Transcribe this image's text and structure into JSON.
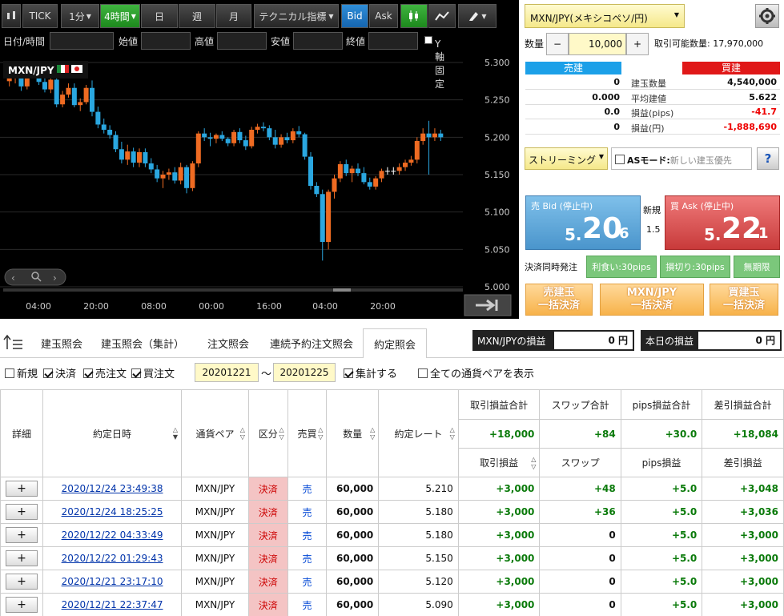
{
  "toolbar": {
    "tick": "TICK",
    "min1": "1分",
    "h4": "4時間",
    "day": "日",
    "week": "週",
    "month": "月",
    "technical": "テクニカル指標",
    "bid": "Bid",
    "ask": "Ask"
  },
  "fields": {
    "datetime": "日付/時間",
    "open": "始値",
    "high": "高値",
    "low": "安値",
    "close": "終値",
    "yfix": "Y軸固定"
  },
  "chart": {
    "symbol": "MXN/JPY",
    "yticks": [
      "5.300",
      "5.250",
      "5.200",
      "5.150",
      "5.100",
      "5.050",
      "5.000"
    ],
    "xticks": [
      "04:00",
      "20:00",
      "08:00",
      "00:00",
      "16:00",
      "04:00",
      "20:00"
    ],
    "colors": {
      "up": "#ef6b22",
      "down": "#2aa7e0",
      "doji": "#ffffff"
    },
    "candles": [
      [
        5.275,
        5.283,
        5.268,
        5.279
      ],
      [
        5.279,
        5.29,
        5.272,
        5.284
      ],
      [
        5.284,
        5.292,
        5.262,
        5.268
      ],
      [
        5.268,
        5.289,
        5.264,
        5.285
      ],
      [
        5.285,
        5.291,
        5.279,
        5.287
      ],
      [
        5.287,
        5.294,
        5.27,
        5.274
      ],
      [
        5.274,
        5.282,
        5.26,
        5.264
      ],
      [
        5.264,
        5.283,
        5.259,
        5.277
      ],
      [
        5.277,
        5.285,
        5.24,
        5.244
      ],
      [
        5.244,
        5.262,
        5.24,
        5.257
      ],
      [
        5.257,
        5.272,
        5.253,
        5.266
      ],
      [
        5.266,
        5.272,
        5.24,
        5.243
      ],
      [
        5.243,
        5.252,
        5.235,
        5.247
      ],
      [
        5.247,
        5.27,
        5.244,
        5.266
      ],
      [
        5.266,
        5.276,
        5.228,
        5.234
      ],
      [
        5.234,
        5.241,
        5.212,
        5.217
      ],
      [
        5.217,
        5.225,
        5.205,
        5.21
      ],
      [
        5.21,
        5.216,
        5.198,
        5.203
      ],
      [
        5.203,
        5.208,
        5.18,
        5.184
      ],
      [
        5.184,
        5.194,
        5.165,
        5.17
      ],
      [
        5.17,
        5.19,
        5.163,
        5.181
      ],
      [
        5.181,
        5.186,
        5.16,
        5.166
      ],
      [
        5.166,
        5.185,
        5.16,
        5.18
      ],
      [
        5.18,
        5.185,
        5.16,
        5.165
      ],
      [
        5.165,
        5.172,
        5.152,
        5.157
      ],
      [
        5.157,
        5.163,
        5.14,
        5.145
      ],
      [
        5.145,
        5.155,
        5.132,
        5.15
      ],
      [
        5.15,
        5.158,
        5.143,
        5.153
      ],
      [
        5.153,
        5.16,
        5.138,
        5.142
      ],
      [
        5.142,
        5.166,
        5.137,
        5.16
      ],
      [
        5.16,
        5.163,
        5.125,
        5.132
      ],
      [
        5.132,
        5.168,
        5.128,
        5.165
      ],
      [
        5.165,
        5.208,
        5.16,
        5.205
      ],
      [
        5.205,
        5.212,
        5.195,
        5.2
      ],
      [
        5.2,
        5.206,
        5.188,
        5.198
      ],
      [
        5.198,
        5.205,
        5.192,
        5.203
      ],
      [
        5.203,
        5.208,
        5.195,
        5.198
      ],
      [
        5.198,
        5.2,
        5.188,
        5.192
      ],
      [
        5.192,
        5.21,
        5.188,
        5.207
      ],
      [
        5.207,
        5.212,
        5.192,
        5.196
      ],
      [
        5.196,
        5.202,
        5.183,
        5.188
      ],
      [
        5.188,
        5.214,
        5.185,
        5.21
      ],
      [
        5.21,
        5.218,
        5.205,
        5.214
      ],
      [
        5.214,
        5.22,
        5.208,
        5.212
      ],
      [
        5.212,
        5.216,
        5.196,
        5.2
      ],
      [
        5.2,
        5.21,
        5.185,
        5.19
      ],
      [
        5.19,
        5.204,
        5.186,
        5.2
      ],
      [
        5.2,
        5.206,
        5.192,
        5.196
      ],
      [
        5.196,
        5.212,
        5.192,
        5.208
      ],
      [
        5.208,
        5.215,
        5.2,
        5.204
      ],
      [
        5.204,
        5.206,
        5.17,
        5.174
      ],
      [
        5.174,
        5.18,
        5.13,
        5.135
      ],
      [
        5.135,
        5.14,
        5.12,
        5.124
      ],
      [
        5.124,
        5.13,
        5.035,
        5.06
      ],
      [
        5.06,
        5.13,
        5.05,
        5.127
      ],
      [
        5.127,
        5.15,
        5.118,
        5.145
      ],
      [
        5.145,
        5.168,
        5.14,
        5.164
      ],
      [
        5.164,
        5.17,
        5.148,
        5.152
      ],
      [
        5.152,
        5.162,
        5.14,
        5.158
      ],
      [
        5.158,
        5.165,
        5.148,
        5.152
      ],
      [
        5.152,
        5.16,
        5.137,
        5.14
      ],
      [
        5.14,
        5.146,
        5.13,
        5.134
      ],
      [
        5.134,
        5.148,
        5.13,
        5.145
      ],
      [
        5.145,
        5.158,
        5.14,
        5.155
      ],
      [
        5.155,
        5.16,
        5.15,
        5.155
      ],
      [
        5.155,
        5.16,
        5.15,
        5.155
      ],
      [
        5.155,
        5.165,
        5.15,
        5.16
      ],
      [
        5.16,
        5.17,
        5.155,
        5.166
      ],
      [
        5.166,
        5.175,
        5.162,
        5.17
      ],
      [
        5.17,
        5.2,
        5.165,
        5.195
      ],
      [
        5.195,
        5.212,
        5.19,
        5.205
      ],
      [
        5.205,
        5.222,
        5.15,
        5.2
      ],
      [
        5.2,
        5.212,
        5.195,
        5.205
      ],
      [
        5.205,
        5.21,
        5.195,
        5.2
      ]
    ]
  },
  "right": {
    "pair": "MXN/JPY(メキシコペソ/円)",
    "qty_label": "数量",
    "qty": "10,000",
    "minus": "−",
    "plus": "+",
    "avail": "取引可能数量: 17,970,000",
    "sell_hdr": "売建",
    "buy_hdr": "買建",
    "rows": [
      {
        "s": "0",
        "l": "建玉数量",
        "b": "4,540,000"
      },
      {
        "s": "0.000",
        "l": "平均建値",
        "b": "5.622"
      },
      {
        "s": "0.0",
        "l": "損益(pips)",
        "b": "-41.7"
      },
      {
        "s": "0",
        "l": "損益(円)",
        "b": "-1,888,690"
      }
    ],
    "streaming": "ストリーミング",
    "as_mode": "ASモード:",
    "as_mode_ph": "新しい建玉優先",
    "help": "?",
    "bid_label": "売 Bid (停止中)",
    "bid_main": "5.20",
    "bid_small": "6",
    "bid_prefix": "5.",
    "bid_big": "20",
    "ask_label": "買 Ask (停止中)",
    "ask_prefix": "5.",
    "ask_big": "22",
    "ask_small": "1",
    "new_label": "新規",
    "spread": "1.5",
    "settle_label": "決済同時発注",
    "take_profit": "利食い:30pips",
    "stop_loss": "損切り:30pips",
    "unlimited": "無期限",
    "btn1a": "売建玉",
    "btn1b": "一括決済",
    "btn2a": "MXN/JPY",
    "btn2b": "一括決済",
    "btn3a": "買建玉",
    "btn3b": "一括決済"
  },
  "bottom": {
    "tabs": [
      "建玉照会",
      "建玉照会（集計）",
      "注文照会",
      "連続予約注文照会",
      "約定照会"
    ],
    "pl_pair_label": "MXN/JPYの損益",
    "pl_pair_val": "0 円",
    "pl_day_label": "本日の損益",
    "pl_day_val": "0 円",
    "f_new": "新規",
    "f_settle": "決済",
    "f_sell": "売注文",
    "f_buy": "買注文",
    "date_from": "20201221",
    "tilde": "〜",
    "date_to": "20201225",
    "f_agg": "集計する",
    "f_all": "全ての通貨ペアを表示",
    "headers": {
      "detail": "詳細",
      "datetime": "約定日時",
      "pair": "通貨ペア",
      "kubun": "区分",
      "side": "売買",
      "qty": "数量",
      "rate": "約定レート",
      "pl_sum": "取引損益合計",
      "swap_sum": "スワップ合計",
      "pips_sum": "pips損益合計",
      "net_sum": "差引損益合計",
      "pl": "取引損益",
      "swap": "スワップ",
      "pips": "pips損益",
      "net": "差引損益"
    },
    "totals": {
      "pl": "+18,000",
      "swap": "+84",
      "pips": "+30.0",
      "net": "+18,084"
    },
    "rows": [
      {
        "btn": "+",
        "dt": "2020/12/24 23:49:38",
        "pair": "MXN/JPY",
        "kubun": "決済",
        "side": "売",
        "qty": "60,000",
        "rate": "5.210",
        "pl": "+3,000",
        "swap": "+48",
        "pips": "+5.0",
        "net": "+3,048"
      },
      {
        "btn": "+",
        "dt": "2020/12/24 18:25:25",
        "pair": "MXN/JPY",
        "kubun": "決済",
        "side": "売",
        "qty": "60,000",
        "rate": "5.180",
        "pl": "+3,000",
        "swap": "+36",
        "pips": "+5.0",
        "net": "+3,036"
      },
      {
        "btn": "+",
        "dt": "2020/12/22 04:33:49",
        "pair": "MXN/JPY",
        "kubun": "決済",
        "side": "売",
        "qty": "60,000",
        "rate": "5.180",
        "pl": "+3,000",
        "swap": "0",
        "pips": "+5.0",
        "net": "+3,000"
      },
      {
        "btn": "+",
        "dt": "2020/12/22 01:29:43",
        "pair": "MXN/JPY",
        "kubun": "決済",
        "side": "売",
        "qty": "60,000",
        "rate": "5.150",
        "pl": "+3,000",
        "swap": "0",
        "pips": "+5.0",
        "net": "+3,000"
      },
      {
        "btn": "+",
        "dt": "2020/12/21 23:17:10",
        "pair": "MXN/JPY",
        "kubun": "決済",
        "side": "売",
        "qty": "60,000",
        "rate": "5.120",
        "pl": "+3,000",
        "swap": "0",
        "pips": "+5.0",
        "net": "+3,000"
      },
      {
        "btn": "+",
        "dt": "2020/12/21 22:37:47",
        "pair": "MXN/JPY",
        "kubun": "決済",
        "side": "売",
        "qty": "60,000",
        "rate": "5.090",
        "pl": "+3,000",
        "swap": "0",
        "pips": "+5.0",
        "net": "+3,000"
      }
    ]
  }
}
